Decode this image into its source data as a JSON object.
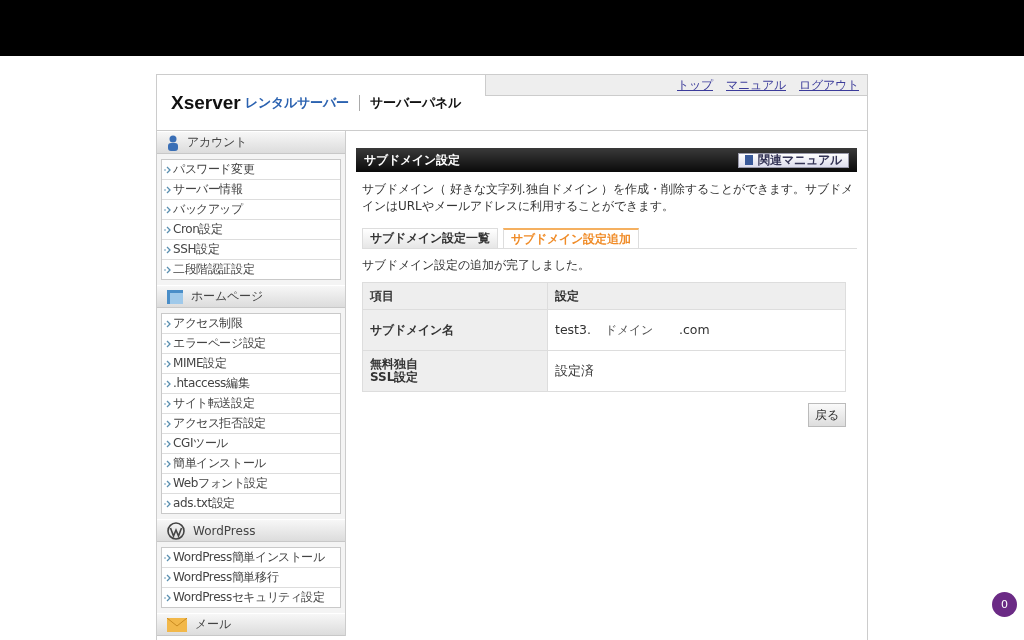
{
  "header": {
    "logo": {
      "brand": "Xserver",
      "product": "レンタルサーバー",
      "panel": "サーバーパネル"
    },
    "links": [
      "トップ",
      "マニュアル",
      "ログアウト"
    ]
  },
  "sidebar": [
    {
      "title": "アカウント",
      "kind": "account",
      "items": [
        "パスワード変更",
        "サーバー情報",
        "バックアップ",
        "Cron設定",
        "SSH設定",
        "二段階認証設定"
      ]
    },
    {
      "title": "ホームページ",
      "kind": "homepage",
      "items": [
        "アクセス制限",
        "エラーページ設定",
        "MIME設定",
        ".htaccess編集",
        "サイト転送設定",
        "アクセス拒否設定",
        "CGIツール",
        "簡単インストール",
        "Webフォント設定",
        "ads.txt設定"
      ]
    },
    {
      "title": "WordPress",
      "kind": "wordpress",
      "items": [
        "WordPress簡単インストール",
        "WordPress簡単移行",
        "WordPressセキュリティ設定"
      ]
    },
    {
      "title": "メール",
      "kind": "mail"
    }
  ],
  "main": {
    "title": "サブドメイン設定",
    "manual_button": "関連マニュアル",
    "description": "サブドメイン（ 好きな文字列.独自ドメイン ）を作成・削除することができます。サブドメインはURLやメールアドレスに利用することができます。",
    "tabs": [
      {
        "label": "サブドメイン設定一覧",
        "selected": false
      },
      {
        "label": "サブドメイン設定追加",
        "selected": true
      }
    ],
    "message": "サブドメイン設定の追加が完了しました。",
    "table": {
      "columns": [
        "項目",
        "設定"
      ],
      "rows": [
        {
          "label": [
            "サブドメイン名"
          ],
          "value": [
            {
              "text": "test3.",
              "small": false
            },
            {
              "text": "ドメイン",
              "small": true
            },
            {
              "text": ".com",
              "small": false
            }
          ]
        },
        {
          "label": [
            "無料独自",
            "SSL設定"
          ],
          "value": [
            {
              "text": "設定済",
              "small": false
            }
          ]
        }
      ]
    },
    "back_button": "戻る"
  },
  "badge": "0"
}
